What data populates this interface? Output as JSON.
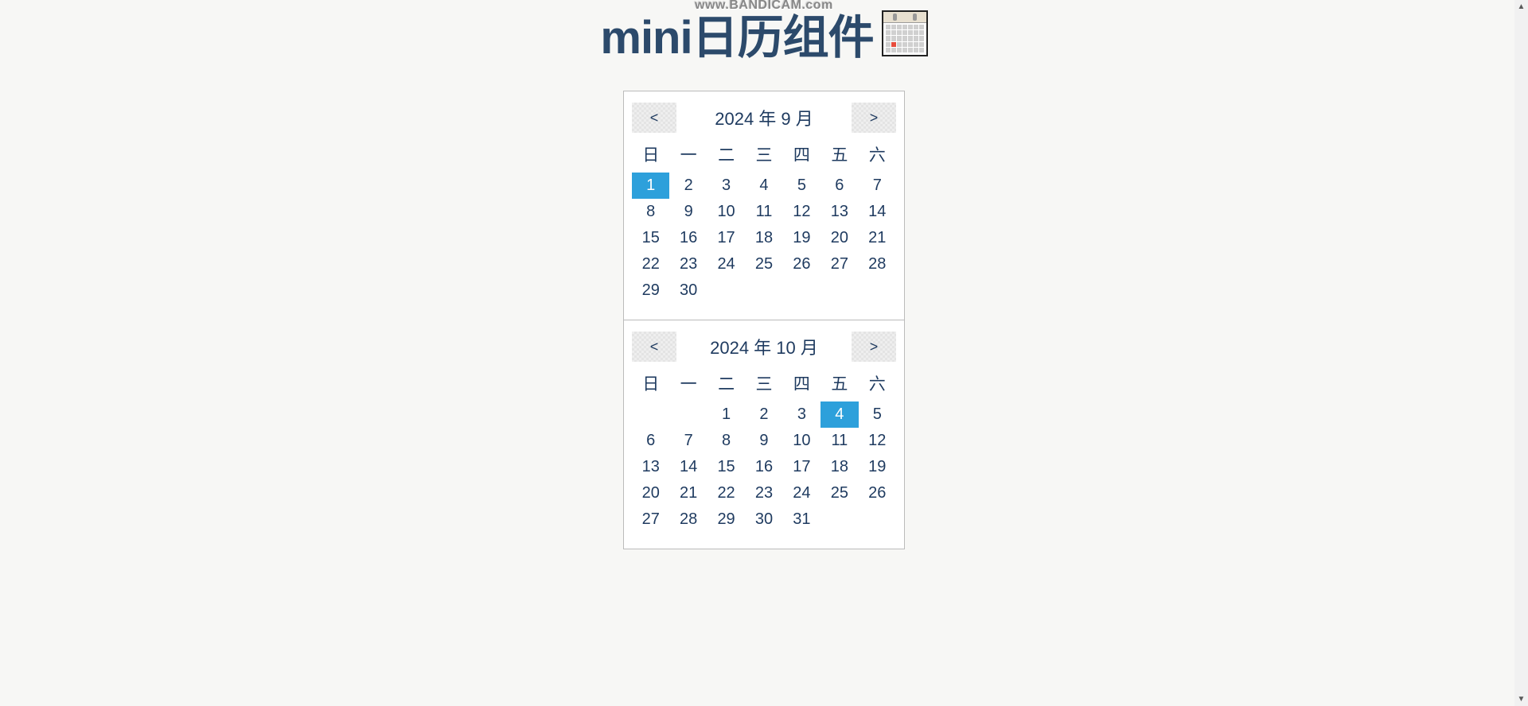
{
  "watermark": "www.BANDICAM.com",
  "title": "mini日历组件",
  "weekdays": [
    "日",
    "一",
    "二",
    "三",
    "四",
    "五",
    "六"
  ],
  "nav": {
    "prev": "<",
    "next": ">"
  },
  "calendars": [
    {
      "label": "2024 年 9 月",
      "leading_blanks": 0,
      "days_in_month": 30,
      "selected": 1
    },
    {
      "label": "2024 年 10 月",
      "leading_blanks": 2,
      "days_in_month": 31,
      "selected": 4
    }
  ]
}
